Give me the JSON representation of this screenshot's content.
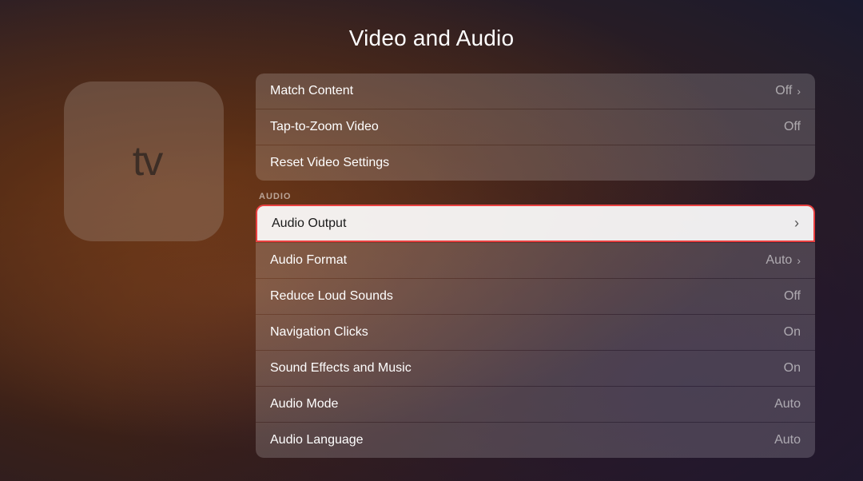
{
  "page": {
    "title": "Video and Audio"
  },
  "section_audio_label": "AUDIO",
  "video_settings": [
    {
      "id": "match-content",
      "label": "Match Content",
      "value": "Off",
      "hasChevron": true
    },
    {
      "id": "tap-to-zoom",
      "label": "Tap-to-Zoom Video",
      "value": "Off",
      "hasChevron": false
    },
    {
      "id": "reset-video",
      "label": "Reset Video Settings",
      "value": "",
      "hasChevron": false
    }
  ],
  "audio_settings": [
    {
      "id": "audio-output",
      "label": "Audio Output",
      "value": "",
      "hasChevron": true,
      "focused": true
    },
    {
      "id": "audio-format",
      "label": "Audio Format",
      "value": "Auto",
      "hasChevron": true
    },
    {
      "id": "reduce-loud-sounds",
      "label": "Reduce Loud Sounds",
      "value": "Off",
      "hasChevron": false
    },
    {
      "id": "navigation-clicks",
      "label": "Navigation Clicks",
      "value": "On",
      "hasChevron": false
    },
    {
      "id": "sound-effects-music",
      "label": "Sound Effects and Music",
      "value": "On",
      "hasChevron": false
    },
    {
      "id": "audio-mode",
      "label": "Audio Mode",
      "value": "Auto",
      "hasChevron": false
    },
    {
      "id": "audio-language",
      "label": "Audio Language",
      "value": "Auto",
      "hasChevron": false
    }
  ],
  "appletv": {
    "apple_symbol": "",
    "tv_text": "tv"
  }
}
